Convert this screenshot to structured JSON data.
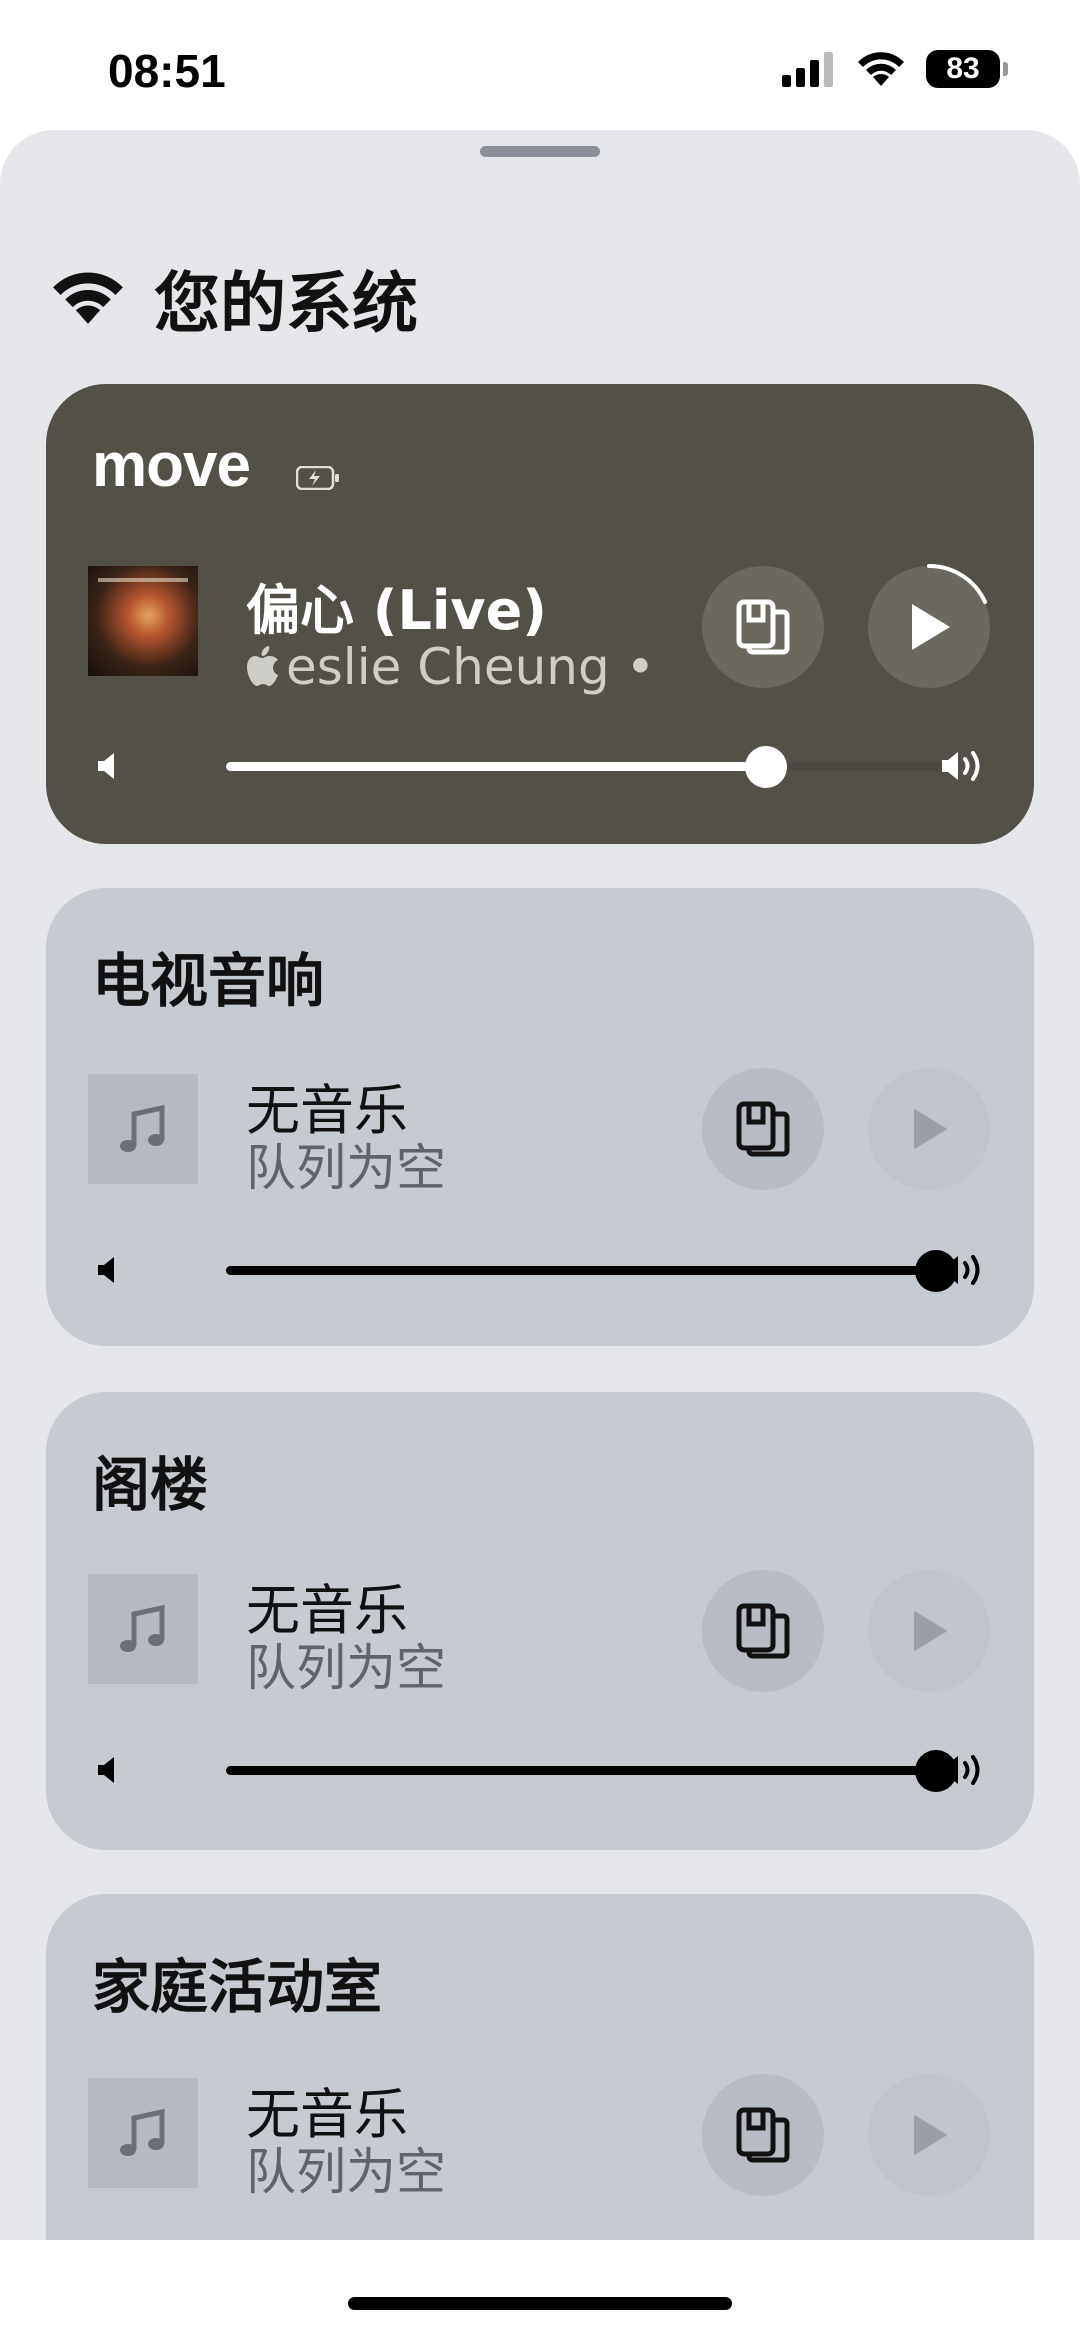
{
  "status_bar": {
    "time": "08:51",
    "battery": "83",
    "icons": [
      "cellular-signal-icon",
      "wifi-icon",
      "battery-icon"
    ]
  },
  "section": {
    "title": "您的系统",
    "icon": "wifi-icon"
  },
  "rooms": [
    {
      "name": "move",
      "active": true,
      "battery_icon": "battery-charging-icon",
      "track_title": "偏心 (Live)",
      "track_subtitle": "eslie Cheung •",
      "source_icon": "apple-music-icon",
      "volume_level": 0.75,
      "playing": false
    },
    {
      "name": "电视音响",
      "active": false,
      "track_title": "无音乐",
      "track_subtitle": "队列为空",
      "volume_level": 1.0
    },
    {
      "name": "阁楼",
      "active": false,
      "track_title": "无音乐",
      "track_subtitle": "队列为空",
      "volume_level": 1.0
    },
    {
      "name": "家庭活动室",
      "active": false,
      "track_title": "无音乐",
      "track_subtitle": "队列为空"
    }
  ],
  "colors": {
    "sheet_bg": "#e5e6e9",
    "active_card": "#525047",
    "idle_card": "#c6cad1"
  }
}
